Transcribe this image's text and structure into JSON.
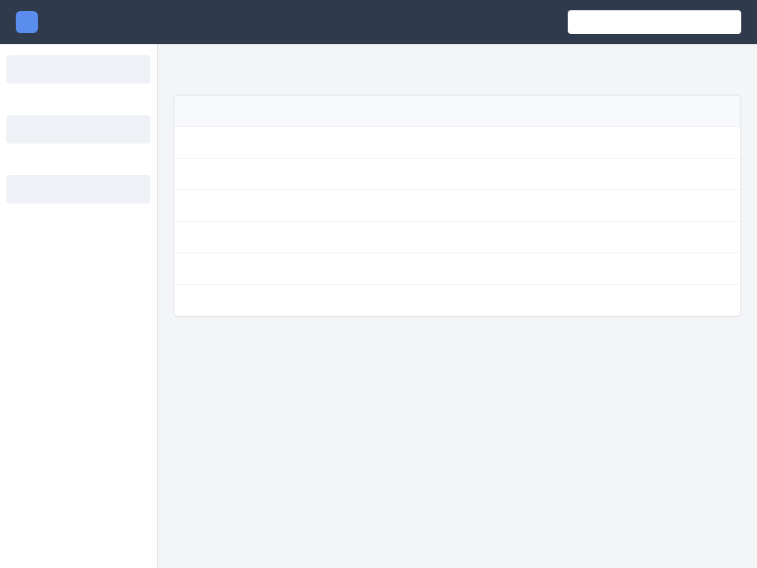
{
  "header": {
    "title": "",
    "search_placeholder": ""
  },
  "main": {
    "title": ""
  }
}
